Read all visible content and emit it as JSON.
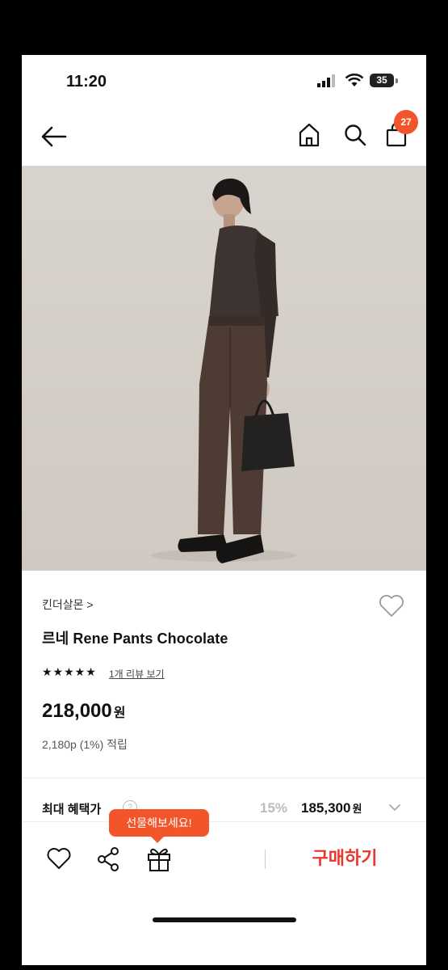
{
  "status_bar": {
    "time": "11:20",
    "battery": "35"
  },
  "nav": {
    "cart_count": "27"
  },
  "product": {
    "brand": "킨더살몬 >",
    "name": "르네 Rene Pants Chocolate",
    "stars": "★★★★★",
    "review_link": "1개 리뷰 보기",
    "price": "218,000",
    "currency": "원",
    "points": "2,180p (1%) 적립"
  },
  "benefit": {
    "label": "최대 혜택가",
    "help": "?",
    "discount": "15%",
    "price": "185,300",
    "currency": "원"
  },
  "bottom_bar": {
    "gift_tooltip": "선물해보세요!",
    "buy_label": "구매하기"
  },
  "colors": {
    "accent": "#f3552a",
    "buy": "#e8372e"
  }
}
